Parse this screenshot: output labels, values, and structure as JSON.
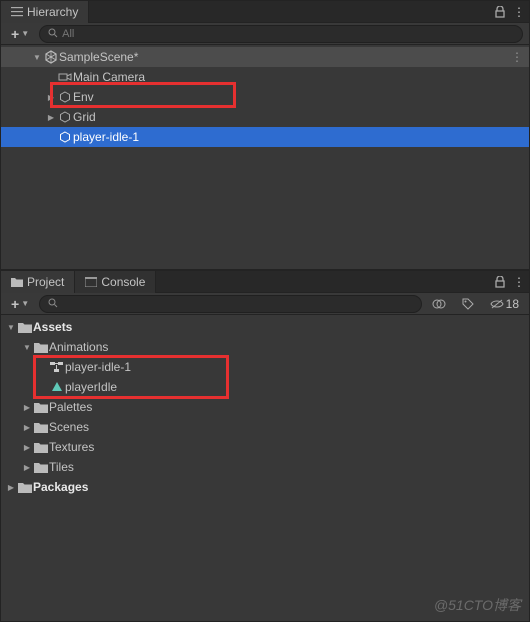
{
  "hierarchy": {
    "tab_label": "Hierarchy",
    "search_placeholder": "All",
    "scene": {
      "name": "SampleScene*"
    },
    "items": [
      {
        "name": "Main Camera"
      },
      {
        "name": "Env"
      },
      {
        "name": "Grid"
      },
      {
        "name": "player-idle-1"
      }
    ]
  },
  "project": {
    "tabs": [
      {
        "label": "Project",
        "active": true
      },
      {
        "label": "Console",
        "active": false
      }
    ],
    "hidden_label": "18",
    "tree": {
      "assets": {
        "label": "Assets",
        "animations": {
          "label": "Animations",
          "items": [
            {
              "name": "player-idle-1",
              "kind": "animator"
            },
            {
              "name": "playerIdle",
              "kind": "animclip"
            }
          ]
        },
        "folders": [
          {
            "name": "Palettes"
          },
          {
            "name": "Scenes"
          },
          {
            "name": "Textures"
          },
          {
            "name": "Tiles"
          }
        ]
      },
      "packages": {
        "label": "Packages"
      }
    }
  },
  "watermark": "@51CTO博客"
}
